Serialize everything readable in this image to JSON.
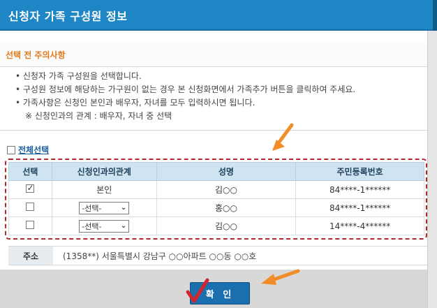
{
  "window": {
    "title": "신청자 가족 구성원 정보"
  },
  "notice": {
    "heading": "선택 전 주의사항",
    "lines": [
      "• 신청자 가족 구성원을 선택합니다.",
      "• 구성원 정보에 해당하는 가구원이 없는 경우 본 신청화면에서 가족추가 버튼을 클릭하여 주세요.",
      "• 가족사항은 신청인 본인과 배우자, 자녀를 모두 입력하시면 됩니다.",
      "※ 신청인과의 관계 : 배우자, 자녀 중 선택"
    ]
  },
  "select_all": {
    "label": "전체선택",
    "checked": false
  },
  "table": {
    "headers": [
      "선택",
      "신청인과의관계",
      "성명",
      "주민등록번호"
    ],
    "rows": [
      {
        "checked": true,
        "relation": "본인",
        "relation_is_select": false,
        "name": "김○○",
        "rrn": "84****-1******"
      },
      {
        "checked": false,
        "relation": "-선택-",
        "relation_is_select": true,
        "name": "홍○○",
        "rrn": "84****-1******"
      },
      {
        "checked": false,
        "relation": "-선택-",
        "relation_is_select": true,
        "name": "김○○",
        "rrn": "14****-4******"
      }
    ]
  },
  "address": {
    "label": "주소",
    "value": "(1358**) 서울특별시 강남구 ○○아파트 ○○동 ○○호"
  },
  "confirm": {
    "label": "확 인"
  },
  "colors": {
    "title_bar": "#1f86c6",
    "accent_orange": "#e07b1c",
    "dash_red": "#b3282d",
    "arrow_orange": "#f28c28",
    "button_blue": "#1c6fae"
  },
  "icons": [
    "checkbox",
    "chevron-down-icon",
    "arrow-annotation",
    "checkmark-icon"
  ]
}
